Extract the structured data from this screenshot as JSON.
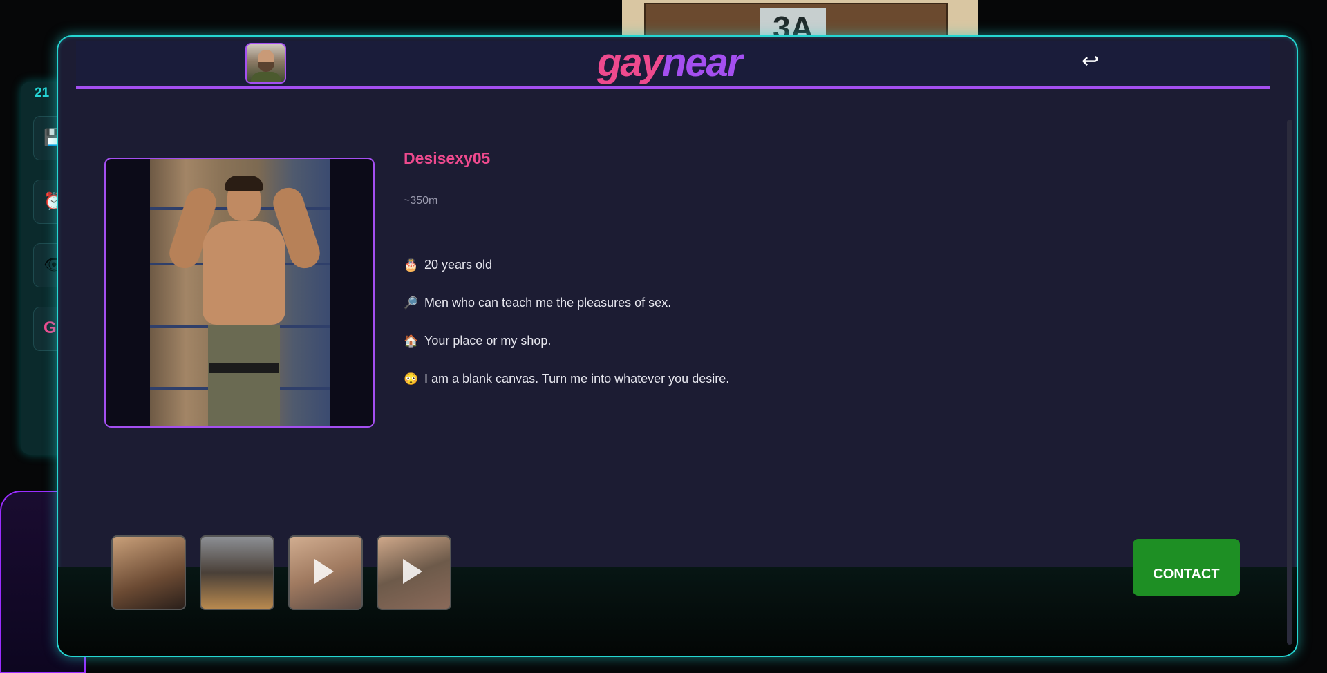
{
  "background": {
    "door_sign": "3A",
    "side_panel_number": "21",
    "side_panel_letter": "G"
  },
  "header": {
    "logo_part1": "gay",
    "logo_part2": "near",
    "back_icon": "↩"
  },
  "profile": {
    "username": "Desisexy05",
    "distance": "~350m",
    "details": [
      {
        "icon": "cake-icon",
        "emoji": "🎂",
        "text": "20 years old"
      },
      {
        "icon": "magnifier-icon",
        "emoji": "🔎",
        "text": "Men who can teach me the pleasures of sex."
      },
      {
        "icon": "house-icon",
        "emoji": "🏠",
        "text": "Your place or my shop."
      },
      {
        "icon": "flushed-face-icon",
        "emoji": "😳",
        "text": "I am a blank canvas. Turn me into whatever you desire."
      }
    ]
  },
  "gallery": {
    "items": [
      {
        "type": "photo"
      },
      {
        "type": "photo"
      },
      {
        "type": "video"
      },
      {
        "type": "video"
      }
    ]
  },
  "actions": {
    "contact_label": "CONTACT"
  },
  "colors": {
    "accent_pink": "#ee4a8e",
    "accent_purple": "#a44ff0",
    "accent_cyan": "#25d6d2",
    "contact_green": "#1e8f24"
  }
}
